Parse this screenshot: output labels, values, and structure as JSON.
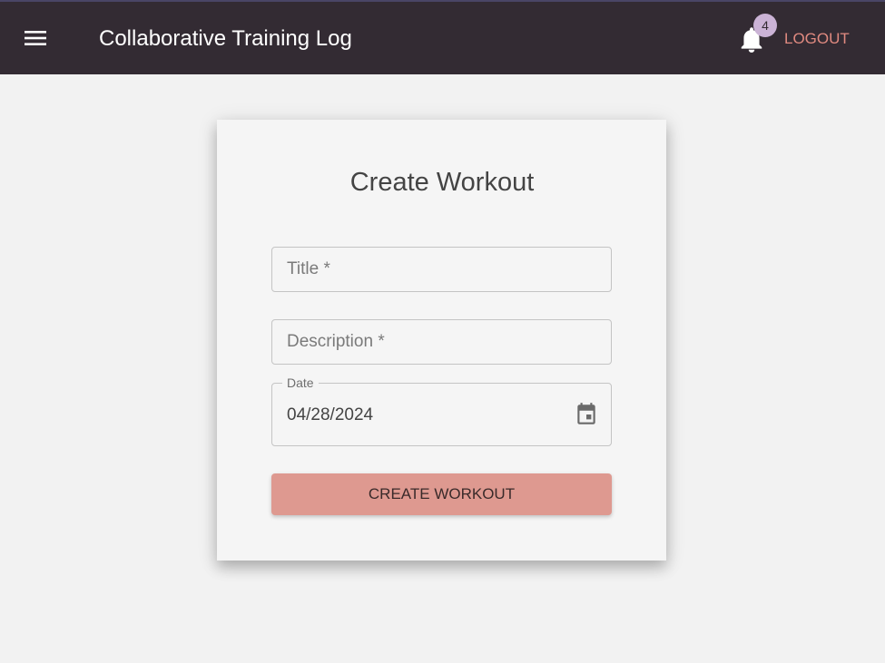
{
  "appbar": {
    "menu_icon": "hamburger-menu-icon",
    "title": "Collaborative Training Log",
    "notifications_icon": "bell-icon",
    "notification_count": "4",
    "logout_label": "LOGOUT",
    "colors": {
      "background": "#332b33",
      "logout_text": "#e08a80",
      "badge": "#cbb3d6"
    }
  },
  "form": {
    "heading": "Create Workout",
    "title_field": {
      "placeholder": "Title *",
      "value": ""
    },
    "description_field": {
      "placeholder": "Description *",
      "value": ""
    },
    "date_field": {
      "label": "Date",
      "value": "04/28/2024",
      "icon": "calendar-icon"
    },
    "submit_label": "CREATE WORKOUT",
    "colors": {
      "submit_button": "#de9990",
      "card": "#f5f5f5",
      "page_background": "#f2f2f2"
    }
  }
}
